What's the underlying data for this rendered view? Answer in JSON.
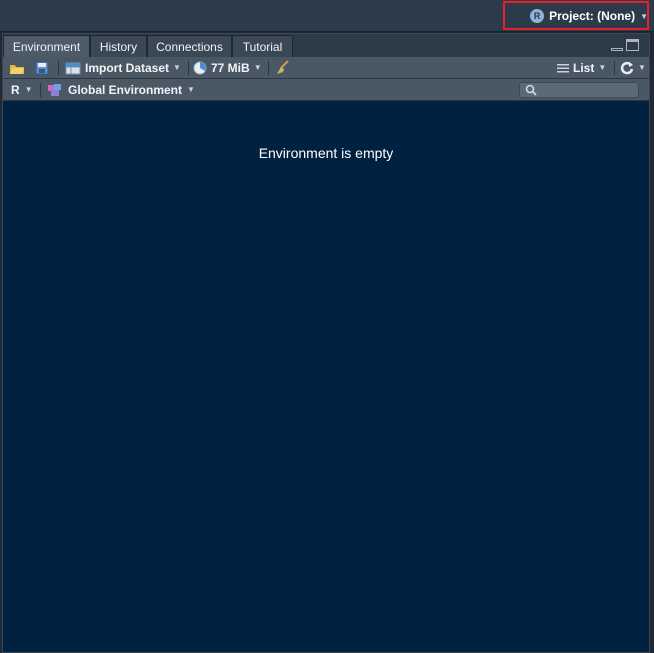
{
  "header": {
    "project_label": "Project: (None)"
  },
  "tabs": [
    {
      "label": "Environment"
    },
    {
      "label": "History"
    },
    {
      "label": "Connections"
    },
    {
      "label": "Tutorial"
    }
  ],
  "toolbar": {
    "import_dataset": "Import Dataset",
    "memory": "77 MiB",
    "view_mode": "List"
  },
  "subbar": {
    "language": "R",
    "environment": "Global Environment"
  },
  "search": {
    "placeholder": ""
  },
  "main": {
    "empty_message": "Environment is empty"
  },
  "colors": {
    "highlight": "#e8202a",
    "pane_bg": "#002240"
  }
}
